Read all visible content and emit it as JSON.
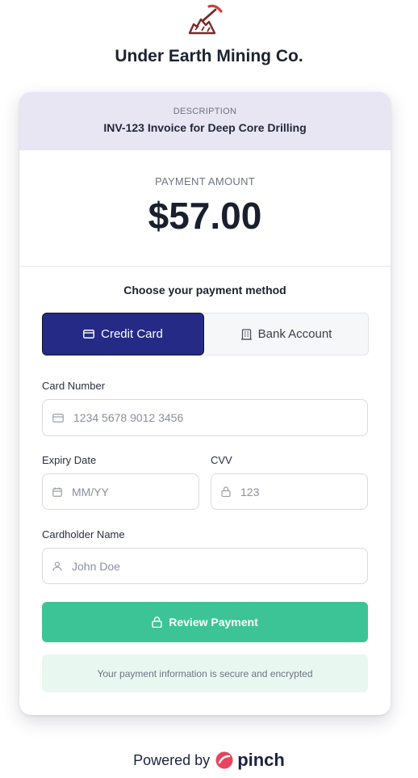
{
  "company": {
    "name": "Under Earth Mining Co."
  },
  "description": {
    "label": "DESCRIPTION",
    "value": "INV-123 Invoice for Deep Core Drilling"
  },
  "payment": {
    "label": "PAYMENT AMOUNT",
    "amount": "$57.00"
  },
  "method": {
    "title": "Choose your payment method",
    "tabs": [
      {
        "label": "Credit Card",
        "icon": "credit-card-icon",
        "selected": true
      },
      {
        "label": "Bank Account",
        "icon": "bank-icon",
        "selected": false
      }
    ]
  },
  "form": {
    "card_number": {
      "label": "Card Number",
      "placeholder": "1234 5678 9012 3456",
      "value": ""
    },
    "expiry": {
      "label": "Expiry Date",
      "placeholder": "MM/YY",
      "value": ""
    },
    "cvv": {
      "label": "CVV",
      "placeholder": "123",
      "value": ""
    },
    "cardholder": {
      "label": "Cardholder Name",
      "placeholder": "John Doe",
      "value": ""
    }
  },
  "actions": {
    "review_label": "Review Payment"
  },
  "security": {
    "note": "Your payment information is secure and encrypted"
  },
  "footer": {
    "powered_by": "Powered by",
    "brand": "pinch"
  },
  "colors": {
    "primary": "#252a86",
    "accent": "#3cc497",
    "header_bg": "#e8e6f3",
    "brand": "#e8445e"
  }
}
